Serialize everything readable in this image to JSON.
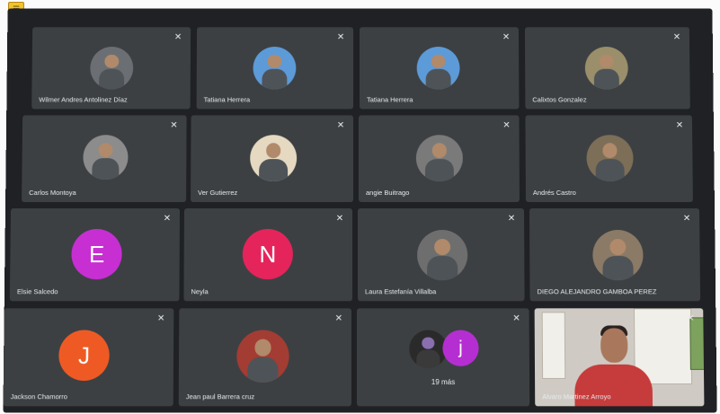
{
  "participants": [
    {
      "name": "Wilmer Andres Antolinez Díaz",
      "avatar": "photo",
      "avatar_bg": "#d9d3c4"
    },
    {
      "name": "Tatiana Herrera",
      "avatar": "photo",
      "avatar_bg": "#5d9ad8"
    },
    {
      "name": "Tatiana Herrera",
      "avatar": "photo",
      "avatar_bg": "#5d9ad8"
    },
    {
      "name": "Calixtos Gonzalez",
      "avatar": "photo",
      "avatar_bg": "#9a8f6a"
    },
    {
      "name": "Carlos Montoya",
      "avatar": "photo",
      "avatar_bg": "#8c8c8c"
    },
    {
      "name": "Ver Gutierrez",
      "avatar": "photo",
      "avatar_bg": "#e6d9c2"
    },
    {
      "name": "angie Buitrago",
      "avatar": "photo",
      "avatar_bg": "#7a7a7a"
    },
    {
      "name": "Andrés Castro",
      "avatar": "photo",
      "avatar_bg": "#7d6e57"
    },
    {
      "name": "Elsie Salcedo",
      "avatar": "letter",
      "letter": "E",
      "avatar_bg": "#c72fd2"
    },
    {
      "name": "Neyla",
      "avatar": "letter",
      "letter": "N",
      "avatar_bg": "#e5245b"
    },
    {
      "name": "Laura Estefanía Villalba",
      "avatar": "photo",
      "avatar_bg": "#6e6e6e"
    },
    {
      "name": "DIEGO ALEJANDRO GAMBOA PEREZ",
      "avatar": "photo",
      "avatar_bg": "#8b7a66"
    },
    {
      "name": "Jackson Chamorro",
      "avatar": "letter",
      "letter": "J",
      "avatar_bg": "#ef5a24"
    },
    {
      "name": "Jean paul Barrera cruz",
      "avatar": "photo",
      "avatar_bg": "#a33c33"
    }
  ],
  "overflow_tile": {
    "letter": "j",
    "letter_bg": "#b52ed1",
    "label": "19 más"
  },
  "self_tile": {
    "name": "Alvaro Martinez Arroyo"
  },
  "mic_muted_icon": "🎙"
}
